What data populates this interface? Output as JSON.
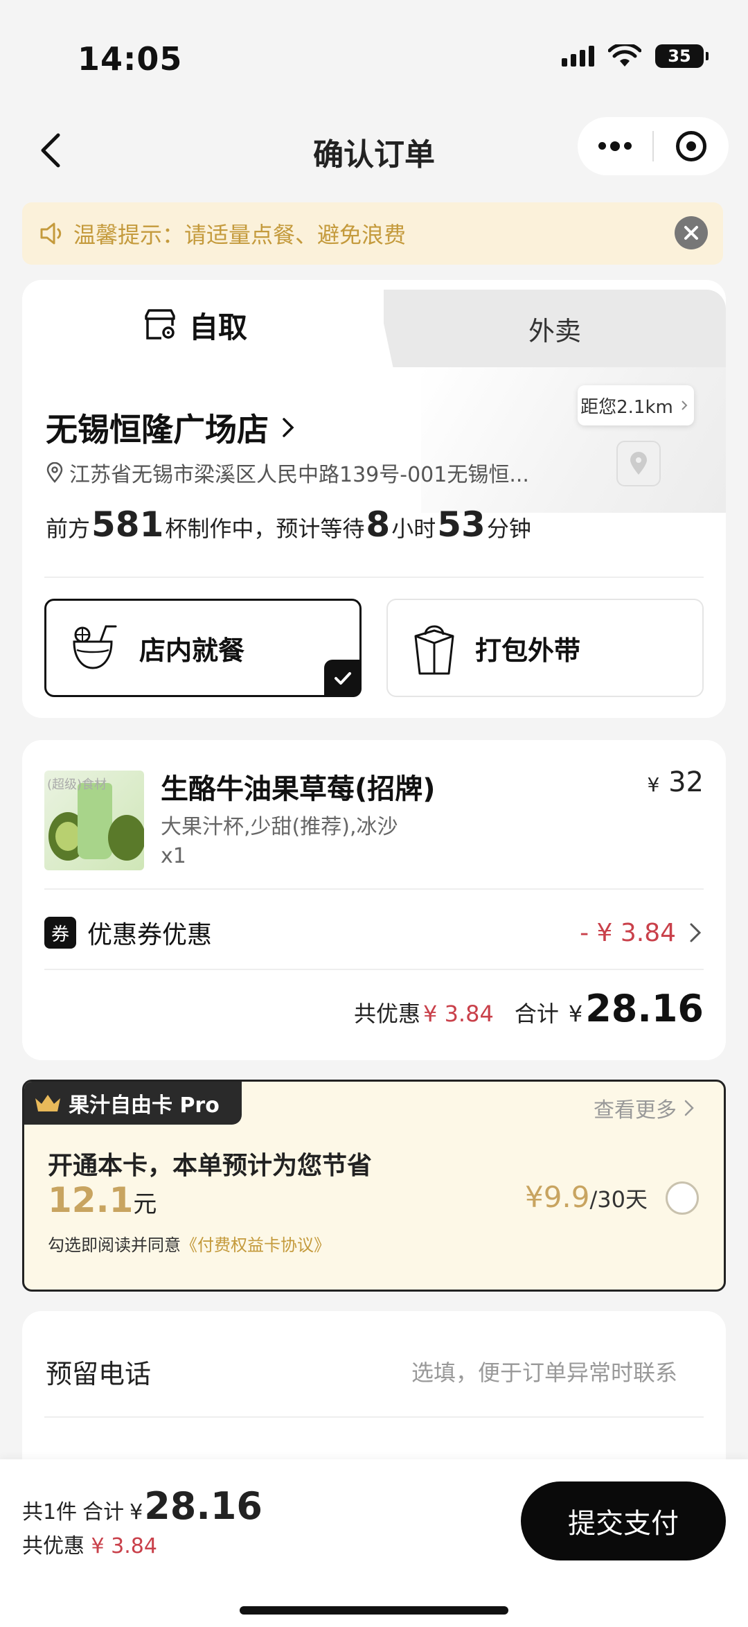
{
  "status_bar": {
    "time": "14:05",
    "battery": "35"
  },
  "nav": {
    "title": "确认订单"
  },
  "notice": {
    "text": "温馨提示：请适量点餐、避免浪费"
  },
  "mode_tabs": {
    "pickup": "自取",
    "delivery": "外卖"
  },
  "store": {
    "name": "无锡恒隆广场店",
    "address": "江苏省无锡市梁溪区人民中路139号-001无锡恒...",
    "distance": "距您2.1km",
    "queue_prefix": "前方",
    "queue_cups": "581",
    "queue_mid": "杯制作中，预计等待",
    "wait_hours": "8",
    "hours_unit": "小时",
    "wait_minutes": "53",
    "minutes_unit": "分钟"
  },
  "dining_options": [
    {
      "label": "店内就餐",
      "selected": true
    },
    {
      "label": "打包外带",
      "selected": false
    }
  ],
  "product": {
    "image_tag": "(超级)食材",
    "name": "生酪牛油果草莓(招牌)",
    "spec": "大果汁杯,少甜(推荐),冰沙",
    "qty": "x1",
    "currency": "¥",
    "price": "32"
  },
  "coupon": {
    "badge": "券",
    "label": "优惠券优惠",
    "amount": "- ¥ 3.84"
  },
  "totals": {
    "discount_label": "共优惠",
    "discount": "¥ 3.84",
    "total_label": "合计",
    "currency": "¥",
    "total": "28.16"
  },
  "membership": {
    "tag": "果汁自由卡 Pro",
    "more": "查看更多",
    "title": "开通本卡，本单预计为您节省",
    "save_amount": "12.1",
    "save_unit": "元",
    "agree_prefix": "勾选即阅读并同意",
    "agree_link": "《付费权益卡协议》",
    "price": "¥9.9",
    "period": "/30天"
  },
  "phone": {
    "label": "预留电话",
    "placeholder": "选填，便于订单异常时联系"
  },
  "bottom_bar": {
    "count": "共1件",
    "total_label": "合计",
    "currency": "¥",
    "total": "28.16",
    "discount_label": "共优惠",
    "discount": "¥ 3.84",
    "pay_label": "提交支付"
  },
  "colors": {
    "accent_red": "#c9404a",
    "gold": "#c8a460",
    "notice_bg": "#fbf1da",
    "dark": "#0a0a0a"
  }
}
